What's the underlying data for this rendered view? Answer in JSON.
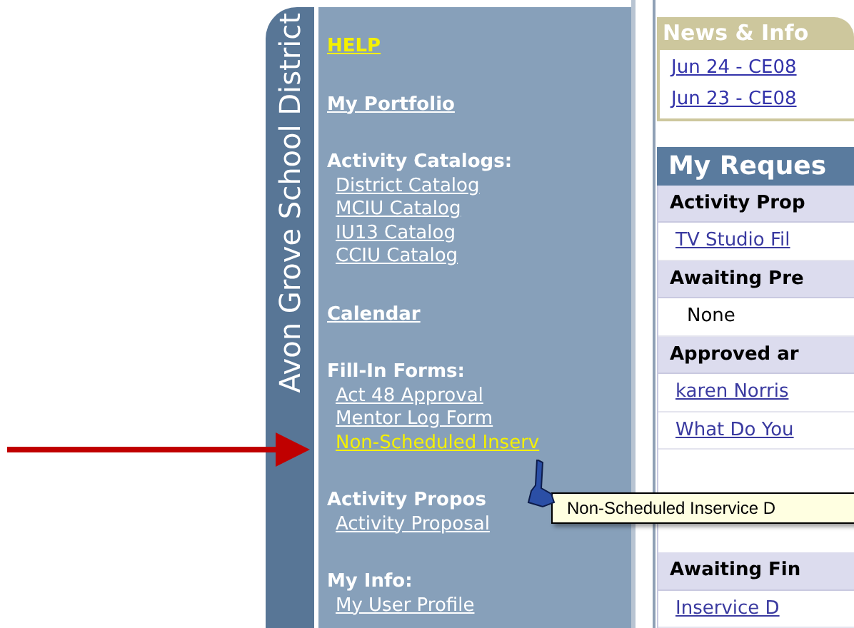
{
  "side_tab": {
    "title": "Avon Grove School District"
  },
  "sidebar": {
    "sections": [
      {
        "items": [
          {
            "kind": "top_link",
            "label": "HELP",
            "highlighted": true
          }
        ]
      },
      {
        "items": [
          {
            "kind": "top_link",
            "label": "My Portfolio",
            "highlighted": false
          }
        ]
      },
      {
        "items": [
          {
            "kind": "heading",
            "label": "Activity Catalogs:",
            "highlighted": false
          },
          {
            "kind": "link",
            "label": "District Catalog",
            "highlighted": false
          },
          {
            "kind": "link",
            "label": "MCIU Catalog",
            "highlighted": false
          },
          {
            "kind": "link",
            "label": "IU13 Catalog",
            "highlighted": false
          },
          {
            "kind": "link",
            "label": "CCIU Catalog",
            "highlighted": false
          }
        ]
      },
      {
        "items": [
          {
            "kind": "top_link",
            "label": "Calendar",
            "highlighted": false
          }
        ]
      },
      {
        "items": [
          {
            "kind": "heading",
            "label": "Fill-In Forms:",
            "highlighted": false
          },
          {
            "kind": "link",
            "label": "Act 48 Approval",
            "highlighted": false
          },
          {
            "kind": "link",
            "label": "Mentor Log Form",
            "highlighted": false
          },
          {
            "kind": "link",
            "label": "Non-Scheduled Inserv",
            "highlighted": true
          }
        ]
      },
      {
        "items": [
          {
            "kind": "heading",
            "label": "Activity Propos",
            "highlighted": false
          },
          {
            "kind": "link",
            "label": "Activity Proposal",
            "highlighted": false
          }
        ]
      },
      {
        "items": [
          {
            "kind": "heading",
            "label": "My Info:",
            "highlighted": false
          },
          {
            "kind": "link",
            "label": "My User Profile",
            "highlighted": false
          }
        ]
      }
    ]
  },
  "news": {
    "title": "News & Info",
    "items": [
      "Jun 24 - CE08",
      "Jun 23 - CE08"
    ]
  },
  "requests": {
    "title": "My Reques",
    "groups": [
      {
        "rows": [
          {
            "kind": "section",
            "text": "Activity Prop"
          },
          {
            "kind": "link",
            "text": "TV Studio Fil"
          },
          {
            "kind": "section",
            "text": "Awaiting Pre"
          },
          {
            "kind": "text",
            "text": "None"
          },
          {
            "kind": "section",
            "text": "Approved ar"
          },
          {
            "kind": "link",
            "text": "karen Norris"
          },
          {
            "kind": "link",
            "text": "What Do You"
          }
        ]
      },
      {
        "rows": [
          {
            "kind": "section",
            "text": "Awaiting Fin"
          },
          {
            "kind": "link",
            "text": "Inservice D"
          }
        ]
      }
    ]
  },
  "tooltip": {
    "text": "Non-Scheduled Inservice D"
  }
}
